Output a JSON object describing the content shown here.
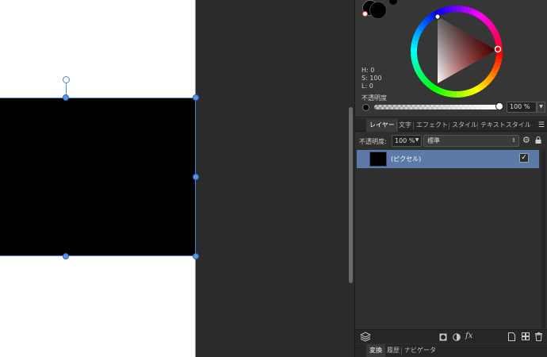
{
  "color": {
    "h_label": "H: 0",
    "s_label": "S: 100",
    "l_label": "L: 0",
    "opacity_label": "不透明度",
    "opacity_value": "100 %",
    "opacity_level": 1.0
  },
  "layers_panel": {
    "tabs": [
      "レイヤー",
      "文字",
      "エフェクト",
      "スタイル",
      "テキストスタイル"
    ],
    "opacity_label": "不透明度:",
    "opacity_value": "100 %",
    "blend_mode": "標準",
    "layers": [
      {
        "name": "(ピクセル)",
        "visible": true
      }
    ]
  },
  "bottom_tabs": [
    "変換",
    "履歴",
    "ナビゲータ"
  ],
  "icons": {
    "layers": "layers-icon",
    "mask": "mask-icon",
    "adjust": "adjustment-icon",
    "fx": "fx",
    "new_doc": "new-layer-icon",
    "group": "group-icon",
    "trash": "trash-icon"
  }
}
